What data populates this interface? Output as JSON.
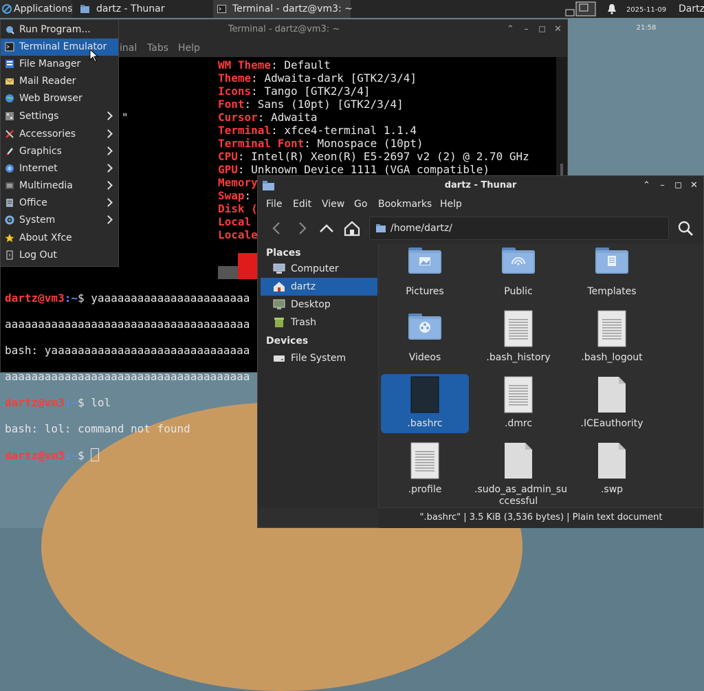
{
  "panel": {
    "apps_label": "Applications",
    "tasks": [
      {
        "label": "dartz - Thunar"
      },
      {
        "label": "Terminal - dartz@vm3: ~"
      }
    ],
    "date": "2025-11-09",
    "time": "21:58",
    "user": "Dartz"
  },
  "terminal": {
    "title": "Terminal - dartz@vm3: ~",
    "menu_partial": "inal",
    "menu_tabs": "Tabs",
    "menu_help": "Help",
    "stray_char": "\"",
    "neofetch": [
      {
        "k": "WM Theme",
        "v": ": Default"
      },
      {
        "k": "Theme",
        "v": ": Adwaita-dark [GTK2/3/4]"
      },
      {
        "k": "Icons",
        "v": ": Tango [GTK2/3/4]"
      },
      {
        "k": "Font",
        "v": ": Sans (10pt) [GTK2/3/4]"
      },
      {
        "k": "Cursor",
        "v": ": Adwaita"
      },
      {
        "k": "Terminal",
        "v": ": xfce4-terminal 1.1.4"
      },
      {
        "k": "Terminal Font",
        "v": ": Monospace (10pt)"
      },
      {
        "k": "CPU",
        "v": ": Intel(R) Xeon(R) E5-2697 v2 (2) @ 2.70 GHz"
      },
      {
        "k": "GPU",
        "v": ": Unknown Device 1111 (VGA compatible)"
      },
      {
        "k": "Memory",
        "v": ""
      },
      {
        "k": "Swap",
        "v": ":"
      },
      {
        "k": "Disk (",
        "v": ""
      },
      {
        "k": "Local",
        "v": ""
      },
      {
        "k": "Locale",
        "v": ""
      }
    ],
    "prompt_user": "dartz@vm3",
    "prompt_path": ":~",
    "prompt_sym": "$ ",
    "cmd1": "yaaaaaaaaaaaaaaaaaaaaaaa",
    "out1": "aaaaaaaaaaaaaaaaaaaaaaaaaaaaaaaaaaaaa",
    "out2": "bash: yaaaaaaaaaaaaaaaaaaaaaaaaaaaaaa",
    "out3": "aaaaaaaaaaaaaaaaaaaaaaaaaaaaaaaaaaaaa",
    "cmd2": "lol",
    "out4": "bash: lol: command not found"
  },
  "appmenu": {
    "items": [
      {
        "label": "Run Program..."
      },
      {
        "label": "Terminal Emulator"
      },
      {
        "label": "File Manager"
      },
      {
        "label": "Mail Reader"
      },
      {
        "label": "Web Browser"
      },
      {
        "label": "Settings"
      },
      {
        "label": "Accessories"
      },
      {
        "label": "Graphics"
      },
      {
        "label": "Internet"
      },
      {
        "label": "Multimedia"
      },
      {
        "label": "Office"
      },
      {
        "label": "System"
      },
      {
        "label": "About Xfce"
      },
      {
        "label": "Log Out"
      }
    ]
  },
  "thunar": {
    "title": "dartz - Thunar",
    "menu": [
      "File",
      "Edit",
      "View",
      "Go",
      "Bookmarks",
      "Help"
    ],
    "location": "/home/dartz/",
    "places_header": "Places",
    "places": [
      {
        "label": "Computer"
      },
      {
        "label": "dartz"
      },
      {
        "label": "Desktop"
      },
      {
        "label": "Trash"
      }
    ],
    "devices_header": "Devices",
    "devices": [
      {
        "label": "File System"
      }
    ],
    "files": [
      {
        "name": "Pictures",
        "kind": "folder-pictures"
      },
      {
        "name": "Public",
        "kind": "folder-public"
      },
      {
        "name": "Templates",
        "kind": "folder-templates"
      },
      {
        "name": "Videos",
        "kind": "folder-videos"
      },
      {
        "name": ".bash_history",
        "kind": "text"
      },
      {
        "name": ".bash_logout",
        "kind": "text"
      },
      {
        "name": ".bashrc",
        "kind": "dark"
      },
      {
        "name": ".dmrc",
        "kind": "text"
      },
      {
        "name": ".ICEauthority",
        "kind": "blank"
      },
      {
        "name": ".profile",
        "kind": "text"
      },
      {
        "name": ".sudo_as_admin_successful",
        "kind": "blank"
      },
      {
        "name": ".swp",
        "kind": "blank"
      }
    ],
    "status": "\".bashrc\"  |  3.5 KiB (3,536 bytes)  |  Plain text document"
  }
}
